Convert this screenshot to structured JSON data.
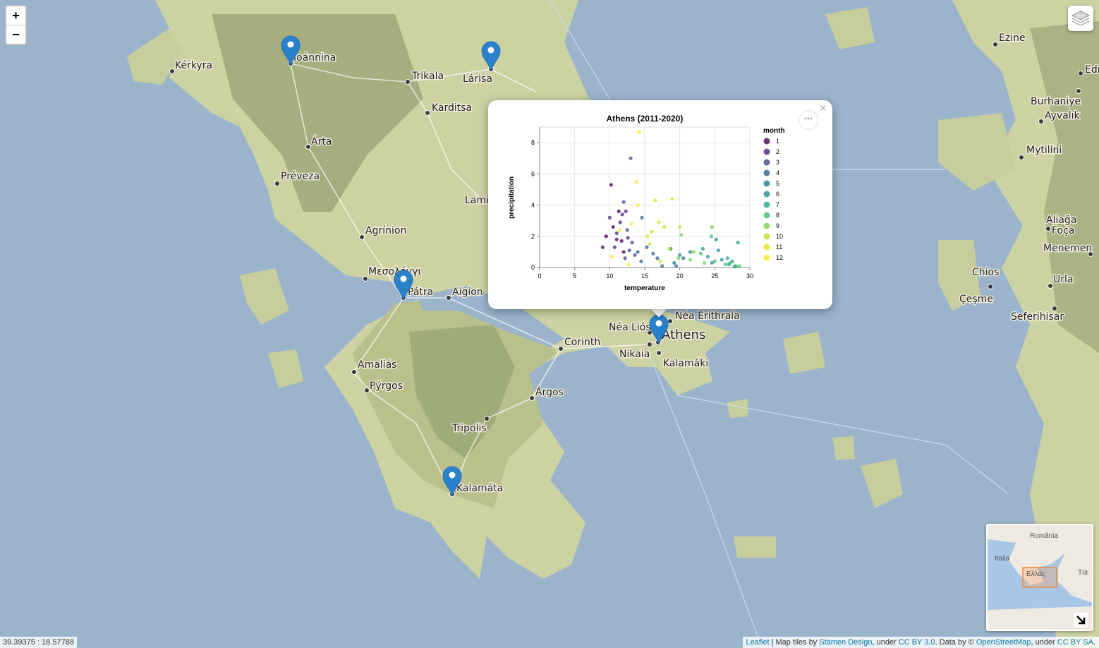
{
  "zoom": {
    "in_label": "+",
    "out_label": "−"
  },
  "cities": [
    {
      "name": "Ioánnina"
    },
    {
      "name": "Kérkyra"
    },
    {
      "name": "Tríkala"
    },
    {
      "name": "Lárisa"
    },
    {
      "name": "Karditsa"
    },
    {
      "name": "Árta"
    },
    {
      "name": "Préveza"
    },
    {
      "name": "Lamia"
    },
    {
      "name": "Agrínion"
    },
    {
      "name": "Μεσολόγγι"
    },
    {
      "name": "Pátra"
    },
    {
      "name": "Aígion"
    },
    {
      "name": "Corinth"
    },
    {
      "name": "Amaliás"
    },
    {
      "name": "Pýrgos"
    },
    {
      "name": "Árgos"
    },
    {
      "name": "Tripolis"
    },
    {
      "name": "Kalamáta"
    },
    {
      "name": "Néa Liósia"
    },
    {
      "name": "Néa Erithraía"
    },
    {
      "name": "Athens"
    },
    {
      "name": "Nikaia"
    },
    {
      "name": "Kalamáki"
    },
    {
      "name": "Ezine"
    },
    {
      "name": "Edr"
    },
    {
      "name": "Burhaniye"
    },
    {
      "name": "Ayvalık"
    },
    {
      "name": "Mytilíni"
    },
    {
      "name": "Aliağa"
    },
    {
      "name": "Foça"
    },
    {
      "name": "Menemen"
    },
    {
      "name": "Chios"
    },
    {
      "name": "Urla"
    },
    {
      "name": "Çeşme"
    },
    {
      "name": "Seferihisar"
    }
  ],
  "markers": [
    "Ioánnina",
    "Lárisa",
    "Pátra",
    "Kalamáta",
    "Athens"
  ],
  "popup": {
    "close_label": "×",
    "menu_label": "•••"
  },
  "chart_data": {
    "type": "scatter",
    "title": "Athens (2011-2020)",
    "xlabel": "temperature",
    "ylabel": "precipitation",
    "xlim": [
      0,
      30
    ],
    "ylim": [
      0,
      9
    ],
    "xticks": [
      0,
      5,
      10,
      15,
      20,
      25,
      30
    ],
    "yticks": [
      0,
      2,
      4,
      6,
      8
    ],
    "legend_title": "month",
    "legend_placement": "right",
    "legend": [
      1,
      2,
      3,
      4,
      5,
      6,
      7,
      8,
      9,
      10,
      11,
      12
    ],
    "colors": [
      "#440154",
      "#482475",
      "#414487",
      "#355f8d",
      "#2a788e",
      "#21918c",
      "#22a884",
      "#42be71",
      "#7ad151",
      "#bddf26",
      "#dde318",
      "#fde725"
    ],
    "points": [
      {
        "x": 9.0,
        "y": 1.3,
        "m": 1
      },
      {
        "x": 9.5,
        "y": 2.0,
        "m": 1
      },
      {
        "x": 10.5,
        "y": 2.6,
        "m": 1
      },
      {
        "x": 11.0,
        "y": 1.8,
        "m": 1
      },
      {
        "x": 11.3,
        "y": 3.6,
        "m": 1
      },
      {
        "x": 12.0,
        "y": 1.0,
        "m": 1
      },
      {
        "x": 10.2,
        "y": 5.3,
        "m": 1
      },
      {
        "x": 11.7,
        "y": 1.7,
        "m": 1
      },
      {
        "x": 10.0,
        "y": 3.2,
        "m": 2
      },
      {
        "x": 11.5,
        "y": 2.9,
        "m": 2
      },
      {
        "x": 12.3,
        "y": 3.6,
        "m": 2
      },
      {
        "x": 10.7,
        "y": 1.3,
        "m": 2
      },
      {
        "x": 11.8,
        "y": 3.4,
        "m": 2
      },
      {
        "x": 12.6,
        "y": 1.9,
        "m": 2
      },
      {
        "x": 11.0,
        "y": 2.2,
        "m": 2
      },
      {
        "x": 13.0,
        "y": 7.0,
        "m": 3
      },
      {
        "x": 12.0,
        "y": 4.2,
        "m": 3
      },
      {
        "x": 12.5,
        "y": 2.4,
        "m": 3
      },
      {
        "x": 13.2,
        "y": 1.6,
        "m": 3
      },
      {
        "x": 12.8,
        "y": 1.1,
        "m": 3
      },
      {
        "x": 13.6,
        "y": 0.8,
        "m": 3
      },
      {
        "x": 12.2,
        "y": 0.6,
        "m": 3
      },
      {
        "x": 14.6,
        "y": 3.2,
        "m": 4
      },
      {
        "x": 15.3,
        "y": 1.3,
        "m": 4
      },
      {
        "x": 14.0,
        "y": 1.0,
        "m": 4
      },
      {
        "x": 16.2,
        "y": 0.9,
        "m": 4
      },
      {
        "x": 17.5,
        "y": 0.1,
        "m": 4
      },
      {
        "x": 14.5,
        "y": 0.4,
        "m": 4
      },
      {
        "x": 16.8,
        "y": 0.6,
        "m": 4
      },
      {
        "x": 19.2,
        "y": 0.3,
        "m": 5
      },
      {
        "x": 20.0,
        "y": 0.8,
        "m": 5
      },
      {
        "x": 21.5,
        "y": 1.0,
        "m": 5
      },
      {
        "x": 18.7,
        "y": 1.2,
        "m": 5
      },
      {
        "x": 20.5,
        "y": 0.6,
        "m": 5
      },
      {
        "x": 19.5,
        "y": 0.1,
        "m": 5
      },
      {
        "x": 23.3,
        "y": 1.2,
        "m": 6
      },
      {
        "x": 24.0,
        "y": 0.7,
        "m": 6
      },
      {
        "x": 25.2,
        "y": 1.8,
        "m": 6
      },
      {
        "x": 24.6,
        "y": 0.3,
        "m": 6
      },
      {
        "x": 26.0,
        "y": 0.5,
        "m": 6
      },
      {
        "x": 25.5,
        "y": 1.1,
        "m": 6
      },
      {
        "x": 27.0,
        "y": 0.2,
        "m": 7
      },
      {
        "x": 27.5,
        "y": 0.4,
        "m": 7
      },
      {
        "x": 28.0,
        "y": 0.1,
        "m": 7
      },
      {
        "x": 28.3,
        "y": 1.6,
        "m": 7
      },
      {
        "x": 26.8,
        "y": 0.6,
        "m": 7
      },
      {
        "x": 27.8,
        "y": 0.05,
        "m": 7
      },
      {
        "x": 26.5,
        "y": 0.2,
        "m": 8
      },
      {
        "x": 27.2,
        "y": 0.3,
        "m": 8
      },
      {
        "x": 24.5,
        "y": 2.0,
        "m": 8
      },
      {
        "x": 25.0,
        "y": 0.4,
        "m": 8
      },
      {
        "x": 28.5,
        "y": 0.1,
        "m": 8
      },
      {
        "x": 23.0,
        "y": 0.9,
        "m": 8
      },
      {
        "x": 20.2,
        "y": 2.1,
        "m": 9
      },
      {
        "x": 21.5,
        "y": 0.5,
        "m": 9
      },
      {
        "x": 22.0,
        "y": 1.0,
        "m": 9
      },
      {
        "x": 24.6,
        "y": 2.6,
        "m": 9
      },
      {
        "x": 19.8,
        "y": 0.6,
        "m": 9
      },
      {
        "x": 23.5,
        "y": 0.3,
        "m": 9
      },
      {
        "x": 16.0,
        "y": 2.3,
        "m": 10
      },
      {
        "x": 17.8,
        "y": 2.6,
        "m": 10
      },
      {
        "x": 18.5,
        "y": 1.2,
        "m": 10
      },
      {
        "x": 20.0,
        "y": 2.6,
        "m": 10
      },
      {
        "x": 17.2,
        "y": 0.4,
        "m": 10
      },
      {
        "x": 15.4,
        "y": 2.0,
        "m": 11
      },
      {
        "x": 17.0,
        "y": 2.9,
        "m": 11
      },
      {
        "x": 18.9,
        "y": 4.4,
        "m": 11
      },
      {
        "x": 16.5,
        "y": 4.3,
        "m": 11
      },
      {
        "x": 15.7,
        "y": 1.5,
        "m": 11
      },
      {
        "x": 14.2,
        "y": 8.7,
        "m": 12
      },
      {
        "x": 13.8,
        "y": 5.5,
        "m": 12
      },
      {
        "x": 14.0,
        "y": 4.0,
        "m": 12
      },
      {
        "x": 12.7,
        "y": 0.2,
        "m": 12
      },
      {
        "x": 10.3,
        "y": 0.7,
        "m": 12
      },
      {
        "x": 13.1,
        "y": 2.8,
        "m": 12
      },
      {
        "x": 11.4,
        "y": 2.4,
        "m": 12
      }
    ]
  },
  "coords_text": "39.39375 : 18.57788",
  "attribution": {
    "leaflet": "Leaflet",
    "sep1": " | Map tiles by ",
    "stamen": "Stamen Design",
    "sep2": ", under ",
    "cc1": "CC BY 3.0",
    "sep3": ". Data by © ",
    "osm": "OpenStreetMap",
    "sep4": ", under ",
    "cc2": "CC BY SA",
    "sep5": "."
  },
  "minimap": {
    "labels": [
      {
        "name": "România"
      },
      {
        "name": "Italia"
      },
      {
        "name": "Ελλάς"
      },
      {
        "name": "Tür"
      }
    ],
    "toggle_icon": "arrow-icon"
  },
  "colors": {
    "sea": "#9bb4cc",
    "land": "#cdd2a3",
    "mountain": "#9aa576",
    "marker": "#2a81cb"
  }
}
